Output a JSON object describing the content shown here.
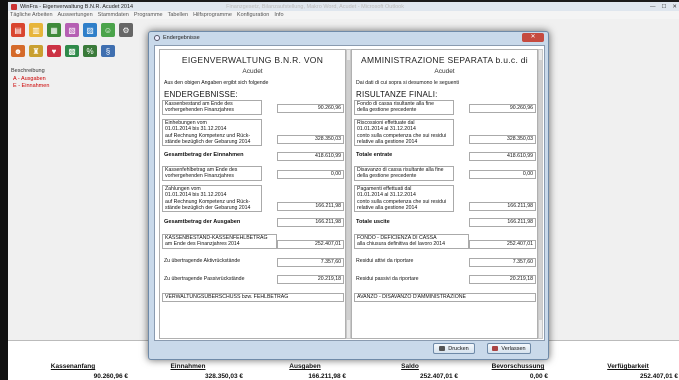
{
  "app": {
    "title": "WinFra - Eigenverwaltung B.N.R. Acudet 2014",
    "faded_title": "Finanzgesetz, Bilanzaufstellung, Makro Word, Acudet - Microsoft Outlook",
    "menu": [
      "Tägliche Arbeiten",
      "Auswertungen",
      "Stammdaten",
      "Programme",
      "Tabellen",
      "Hilfsprogramme",
      "Konfiguration",
      "Info"
    ],
    "tree": {
      "header": "Beschreibung",
      "nodes": [
        "A - Ausgaben",
        "E - Einnahmen"
      ]
    }
  },
  "footer": {
    "columns": [
      {
        "label": "Kassenanfang",
        "value": "90.260,96 €"
      },
      {
        "label": "Einnahmen",
        "value": "328.350,03 €"
      },
      {
        "label": "Ausgaben",
        "value": "166.211,98 €"
      },
      {
        "label": "Saldo",
        "value": "252.407,01 €"
      },
      {
        "label": "Bevorschussung",
        "value": "0,00 €"
      },
      {
        "label": "Verfügbarkeit",
        "value": "252.407,01 €"
      }
    ]
  },
  "dialog": {
    "title": "Endergebnisse",
    "close_label": "✕",
    "buttons": {
      "print": "Drucken",
      "close": "Verlassen"
    },
    "left": {
      "title": "EIGENVERWALTUNG B.N.R. VON",
      "subtitle": "Acudet",
      "intro": "Aus den obigen Angaben ergibt sich folgende",
      "heading": "ENDERGEBNISSE:",
      "rows": [
        {
          "text": "Kassenbestand am Ende des\nvorhergehenden Finanzjahres",
          "value": "90.260,96"
        },
        {
          "text": "Einhebungen vom\n01.01.2014 bis 31.12.2014\nauf Rechnung Kompetenz und Rück-\nstände bezüglich der Gebarung 2014",
          "value": "328.350,03"
        },
        {
          "text": "Gesamtbetrag der Einnahmen",
          "value": "418.610,99",
          "bold": true
        },
        {
          "text": "Kassenfehlbetrag am Ende des\nvorhergehenden Finanzjahres",
          "value": "0,00"
        },
        {
          "text": "Zahlungen vom\n01.01.2014 bis 31.12.2014\nauf Rechnung Kompetenz und Rück-\nstände bezüglich der Gebarung 2014",
          "value": "166.211,98"
        },
        {
          "text": "Gesamtbetrag der Ausgaben",
          "value": "166.211,98",
          "bold": true
        },
        {
          "text": "KASSENBESTAND-KASSENFEHLBETRAG\nam Ende des Finanzjahres 2014",
          "value": "252.407,01"
        },
        {
          "text": "Zu übertragende Aktivrückstände",
          "value": "7.357,60"
        },
        {
          "text": "Zu übertragende Passivrückstände",
          "value": "20.219,18"
        },
        {
          "text": "VERWALTUNGSÜBERSCHUSS bzw. FEHLBETRAG",
          "value": ""
        }
      ]
    },
    "right": {
      "title": "AMMINISTRAZIONE SEPARATA b.u.c. di",
      "subtitle": "Acudet",
      "intro": "Dai dati di cui sopra si desumono le seguenti",
      "heading": "RISULTANZE FINALI:",
      "rows": [
        {
          "text": "Fondo di cassa risultante alla fine\ndella gestione precedente",
          "value": "90.260,96"
        },
        {
          "text": "Riscossioni effettuate dal\n01.01.2014 al 31.12.2014\nconto sulla competenza che sui residui\nrelative alla gestione 2014",
          "value": "328.350,03"
        },
        {
          "text": "Totale entrate",
          "value": "418.610,99",
          "bold": true
        },
        {
          "text": "Disavanzo di cassa risultante alla fine\ndella gestione precedente",
          "value": "0,00"
        },
        {
          "text": "Pagamenti effettuati dal\n01.01.2014 al 31.12.2014\nconto sulla competenza che sui residui\nrelative alla gestione 2014",
          "value": "166.211,98"
        },
        {
          "text": "Totale uscite",
          "value": "166.211,98",
          "bold": true
        },
        {
          "text": "FONDO - DEFICIENZA DI CASSA\nalla chiusura definitiva del lavoro 2014",
          "value": "252.407,01"
        },
        {
          "text": "Residui attivi da riportare",
          "value": "7.357,60"
        },
        {
          "text": "Residui passivi da riportare",
          "value": "20.219,18"
        },
        {
          "text": "AVANZO - DISAVANZO D'AMMINISTRAZIONE",
          "value": ""
        }
      ]
    }
  }
}
